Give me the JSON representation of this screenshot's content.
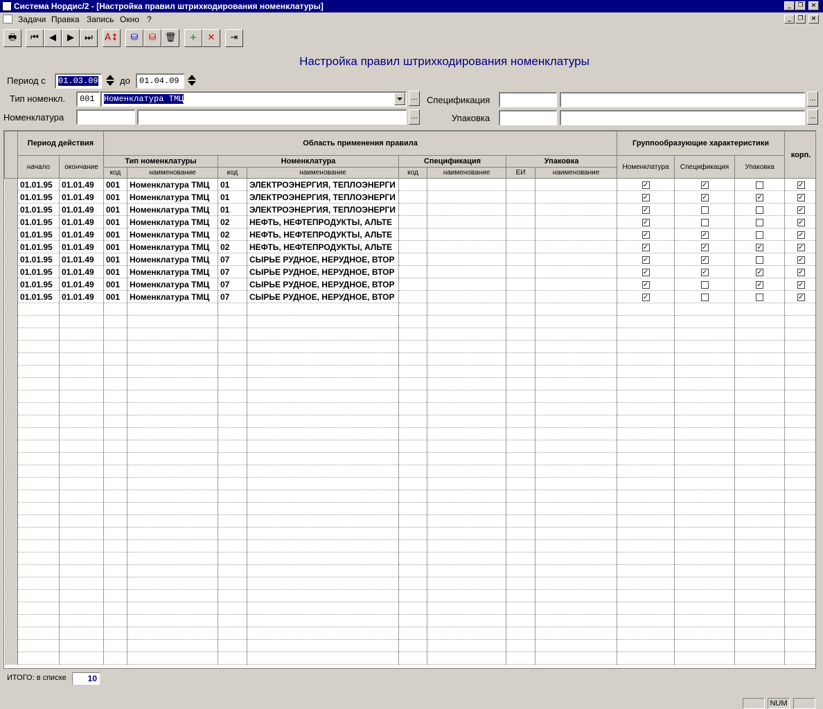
{
  "window": {
    "title": "Система Нордис/2 - [Настройка правил штрихкодирования номенклатуры]"
  },
  "menu": [
    "Задачи",
    "Правка",
    "Запись",
    "Окно",
    "?"
  ],
  "toolbar": {
    "icons": [
      "printer-icon",
      "first-record-icon",
      "prev-record-icon",
      "next-record-icon",
      "last-record-icon",
      "sort-icon",
      "db-save-icon",
      "db-load-icon",
      "basket-icon",
      "add-record-icon",
      "delete-record-icon",
      "exit-icon"
    ]
  },
  "form": {
    "title": "Настройка правил штрихкодирования номенклатуры",
    "period_from_label": "Период с",
    "period_from": "01.03.09",
    "period_to_label": "до",
    "period_to": "01.04.09",
    "type_label": "Тип номенкл.",
    "type_code": "001",
    "type_name": "Номенклатура ТМЦ",
    "nomen_label": "Номенклатура",
    "nomen_code": "",
    "nomen_name": "",
    "spec_label": "Спецификация",
    "spec_code": "",
    "spec_name": "",
    "pack_label": "Упаковка",
    "pack_code": "",
    "pack_name": "",
    "dots": "..."
  },
  "grid": {
    "headers": {
      "period": "Период действия",
      "scope": "Область применения правила",
      "group": "Группообразующие характеристики",
      "corp": "корп.",
      "start": "начало",
      "end": "окончание",
      "type": "Тип номенклатуры",
      "nomen": "Номенклатура",
      "spec": "Спецификация",
      "pack": "Упаковка",
      "code": "код",
      "name": "наименование",
      "ei": "ЕИ",
      "g_nomen": "Номенклатура",
      "g_spec": "Спецификация",
      "g_pack": "Упаковка"
    },
    "rows": [
      {
        "start": "01.01.95",
        "end": "01.01.49",
        "tcode": "001",
        "tname": "Номенклатура ТМЦ",
        "ncode": "01",
        "nname": "ЭЛЕКТРОЭНЕРГИЯ, ТЕПЛОЭНЕРГИ",
        "g_nomen": true,
        "g_spec": true,
        "g_pack": false,
        "corp": true
      },
      {
        "start": "01.01.95",
        "end": "01.01.49",
        "tcode": "001",
        "tname": "Номенклатура ТМЦ",
        "ncode": "01",
        "nname": "ЭЛЕКТРОЭНЕРГИЯ, ТЕПЛОЭНЕРГИ",
        "g_nomen": true,
        "g_spec": true,
        "g_pack": true,
        "corp": true
      },
      {
        "start": "01.01.95",
        "end": "01.01.49",
        "tcode": "001",
        "tname": "Номенклатура ТМЦ",
        "ncode": "01",
        "nname": "ЭЛЕКТРОЭНЕРГИЯ, ТЕПЛОЭНЕРГИ",
        "g_nomen": true,
        "g_spec": false,
        "g_pack": false,
        "corp": true
      },
      {
        "start": "01.01.95",
        "end": "01.01.49",
        "tcode": "001",
        "tname": "Номенклатура ТМЦ",
        "ncode": "02",
        "nname": "НЕФТЬ, НЕФТЕПРОДУКТЫ, АЛЬТЕ",
        "g_nomen": true,
        "g_spec": false,
        "g_pack": false,
        "corp": true
      },
      {
        "start": "01.01.95",
        "end": "01.01.49",
        "tcode": "001",
        "tname": "Номенклатура ТМЦ",
        "ncode": "02",
        "nname": "НЕФТЬ, НЕФТЕПРОДУКТЫ, АЛЬТЕ",
        "g_nomen": true,
        "g_spec": true,
        "g_pack": false,
        "corp": true
      },
      {
        "start": "01.01.95",
        "end": "01.01.49",
        "tcode": "001",
        "tname": "Номенклатура ТМЦ",
        "ncode": "02",
        "nname": "НЕФТЬ, НЕФТЕПРОДУКТЫ, АЛЬТЕ",
        "g_nomen": true,
        "g_spec": true,
        "g_pack": true,
        "corp": true
      },
      {
        "start": "01.01.95",
        "end": "01.01.49",
        "tcode": "001",
        "tname": "Номенклатура ТМЦ",
        "ncode": "07",
        "nname": "СЫРЬЕ РУДНОЕ, НЕРУДНОЕ, ВТОР",
        "g_nomen": true,
        "g_spec": true,
        "g_pack": false,
        "corp": true
      },
      {
        "start": "01.01.95",
        "end": "01.01.49",
        "tcode": "001",
        "tname": "Номенклатура ТМЦ",
        "ncode": "07",
        "nname": "СЫРЬЕ РУДНОЕ, НЕРУДНОЕ, ВТОР",
        "g_nomen": true,
        "g_spec": true,
        "g_pack": true,
        "corp": true
      },
      {
        "start": "01.01.95",
        "end": "01.01.49",
        "tcode": "001",
        "tname": "Номенклатура ТМЦ",
        "ncode": "07",
        "nname": "СЫРЬЕ РУДНОЕ, НЕРУДНОЕ, ВТОР",
        "g_nomen": true,
        "g_spec": false,
        "g_pack": true,
        "corp": true
      },
      {
        "start": "01.01.95",
        "end": "01.01.49",
        "tcode": "001",
        "tname": "Номенклатура ТМЦ",
        "ncode": "07",
        "nname": "СЫРЬЕ РУДНОЕ, НЕРУДНОЕ, ВТОР",
        "g_nomen": true,
        "g_spec": false,
        "g_pack": false,
        "corp": true
      }
    ]
  },
  "footer": {
    "total_label": "ИТОГО: в списке",
    "total_value": "10"
  },
  "statusbar": {
    "num": "NUM"
  }
}
